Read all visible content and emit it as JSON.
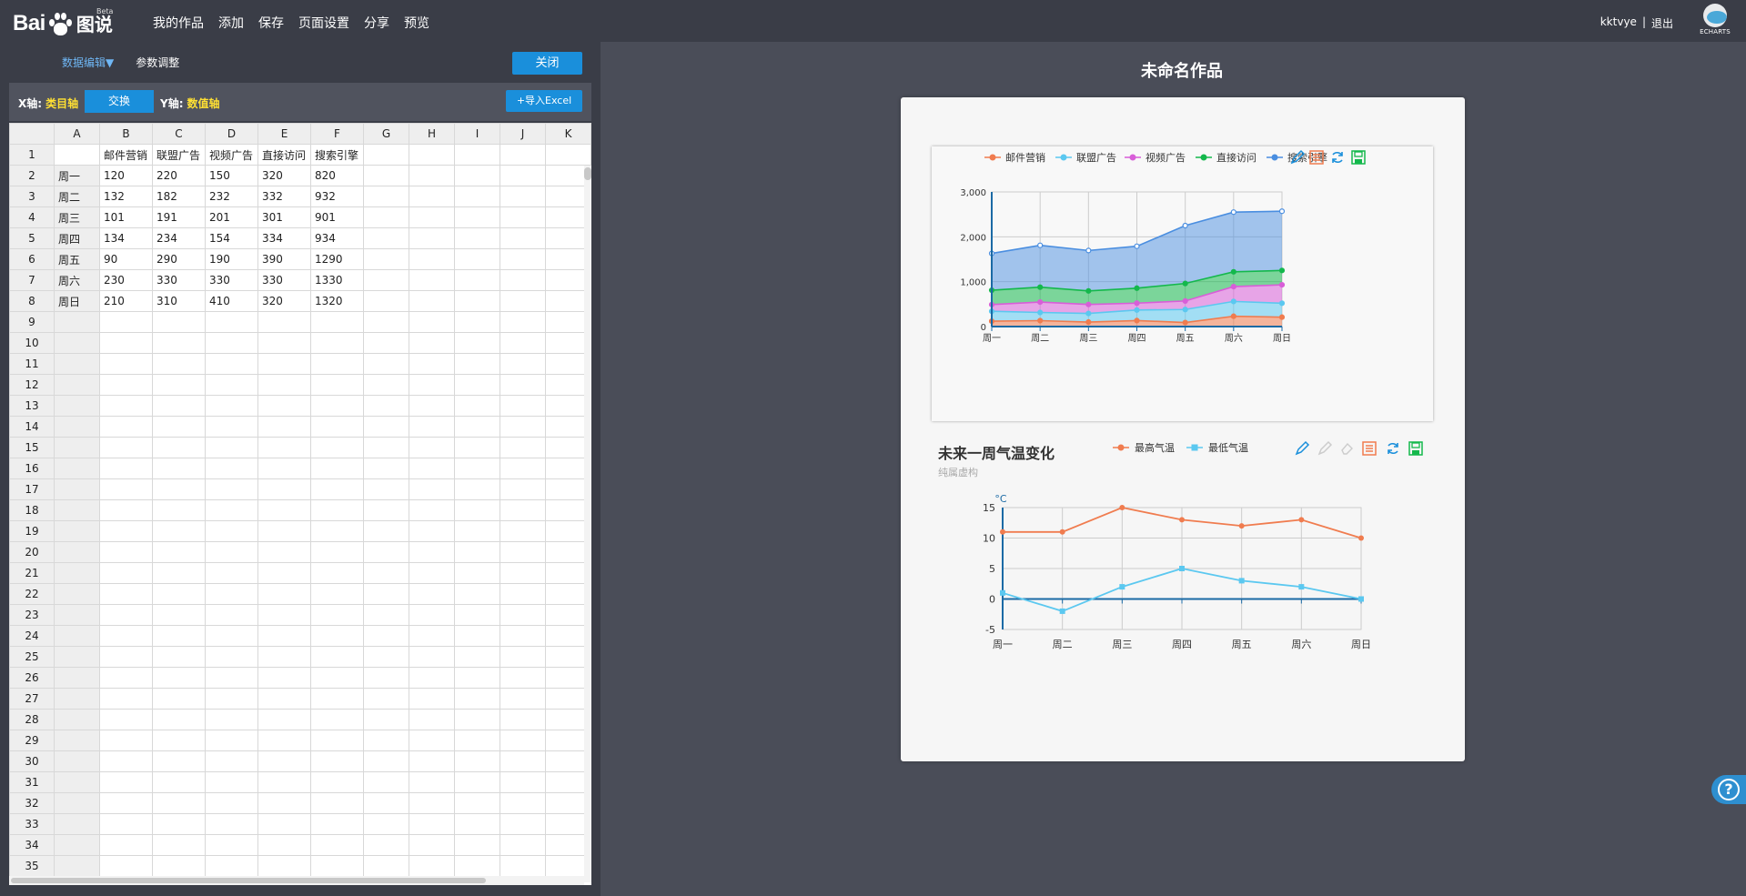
{
  "topbar": {
    "logo_text": "Bai",
    "logo_cn": "图说",
    "logo_beta": "Beta",
    "nav": [
      "我的作品",
      "添加",
      "保存",
      "页面设置",
      "分享",
      "预览"
    ],
    "user": "kktvye",
    "separator": "|",
    "logout": "退出",
    "echarts_label": "ECHARTS"
  },
  "left_panel": {
    "tab_data_edit": "数据编辑▼",
    "tab_params": "参数调整",
    "close_label": "关闭",
    "x_axis_label": "X轴:",
    "x_axis_value": "类目轴",
    "swap_label": "交换",
    "y_axis_label": "Y轴:",
    "y_axis_value": "数值轴",
    "import_excel_label": "+导入Excel"
  },
  "sheet": {
    "columns": [
      "A",
      "B",
      "C",
      "D",
      "E",
      "F",
      "G",
      "H",
      "I",
      "J",
      "K"
    ],
    "rows": [
      [
        "",
        "邮件营销",
        "联盟广告",
        "视频广告",
        "直接访问",
        "搜索引擎"
      ],
      [
        "周一",
        "120",
        "220",
        "150",
        "320",
        "820"
      ],
      [
        "周二",
        "132",
        "182",
        "232",
        "332",
        "932"
      ],
      [
        "周三",
        "101",
        "191",
        "201",
        "301",
        "901"
      ],
      [
        "周四",
        "134",
        "234",
        "154",
        "334",
        "934"
      ],
      [
        "周五",
        "90",
        "290",
        "190",
        "390",
        "1290"
      ],
      [
        "周六",
        "230",
        "330",
        "330",
        "330",
        "1330"
      ],
      [
        "周日",
        "210",
        "310",
        "410",
        "320",
        "1320"
      ]
    ],
    "row_count": 35
  },
  "work": {
    "title": "未命名作品"
  },
  "chart_data": [
    {
      "type": "area",
      "stacked": true,
      "categories": [
        "周一",
        "周二",
        "周三",
        "周四",
        "周五",
        "周六",
        "周日"
      ],
      "series": [
        {
          "name": "邮件营销",
          "values": [
            120,
            132,
            101,
            134,
            90,
            230,
            210
          ],
          "color": "#f07c4f"
        },
        {
          "name": "联盟广告",
          "values": [
            220,
            182,
            191,
            234,
            290,
            330,
            310
          ],
          "color": "#5bc8f0"
        },
        {
          "name": "视频广告",
          "values": [
            150,
            232,
            201,
            154,
            190,
            330,
            410
          ],
          "color": "#d85ed8"
        },
        {
          "name": "直接访问",
          "values": [
            320,
            332,
            301,
            334,
            390,
            330,
            320
          ],
          "color": "#14b84c"
        },
        {
          "name": "搜索引擎",
          "values": [
            820,
            932,
            901,
            934,
            1290,
            1330,
            1320
          ],
          "color": "#4a8ee0"
        }
      ],
      "y_ticks": [
        "0",
        "1,000",
        "2,000",
        "3,000"
      ],
      "ylim": [
        0,
        3000
      ],
      "legend_position": "top"
    },
    {
      "type": "line",
      "title": "未来一周气温变化",
      "subtitle": "纯属虚构",
      "unit_label": "°C",
      "categories": [
        "周一",
        "周二",
        "周三",
        "周四",
        "周五",
        "周六",
        "周日"
      ],
      "series": [
        {
          "name": "最高气温",
          "values": [
            11,
            11,
            15,
            13,
            12,
            13,
            10
          ],
          "color": "#f07c4f"
        },
        {
          "name": "最低气温",
          "values": [
            1,
            -2,
            2,
            5,
            3,
            2,
            0
          ],
          "color": "#5bc8f0"
        }
      ],
      "y_ticks": [
        "-5",
        "0",
        "5",
        "10",
        "15"
      ],
      "ylim": [
        -5,
        15
      ],
      "legend_position": "top"
    }
  ],
  "help_label": "?"
}
